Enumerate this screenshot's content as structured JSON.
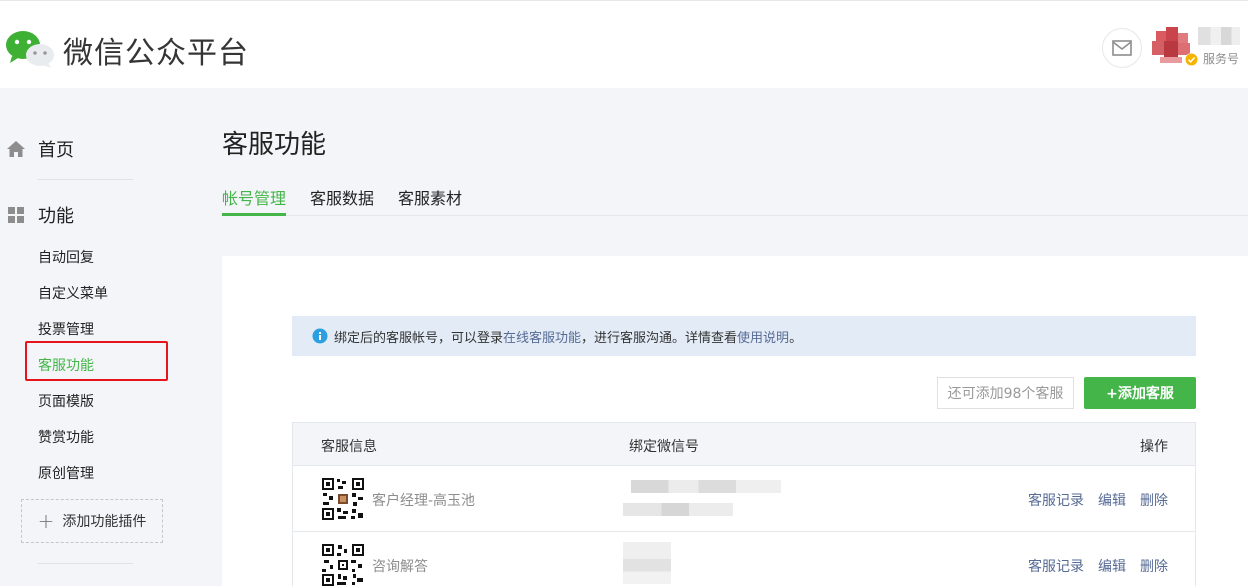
{
  "header": {
    "logo_text": "微信公众平台",
    "account_type": "服务号"
  },
  "sidebar": {
    "home_label": "首页",
    "function_label": "功能",
    "items": [
      {
        "label": "自动回复"
      },
      {
        "label": "自定义菜单"
      },
      {
        "label": "投票管理"
      },
      {
        "label": "客服功能",
        "active": true
      },
      {
        "label": "页面模版"
      },
      {
        "label": "赞赏功能"
      },
      {
        "label": "原创管理"
      }
    ],
    "add_plugin_label": "添加功能插件"
  },
  "main": {
    "title": "客服功能",
    "tabs": [
      {
        "label": "帐号管理",
        "active": true
      },
      {
        "label": "客服数据"
      },
      {
        "label": "客服素材"
      }
    ],
    "notice": {
      "text_before": "绑定后的客服帐号，可以登录",
      "link1": "在线客服功能",
      "text_middle": "，进行客服沟通。详情查看",
      "link2": "使用说明",
      "text_after": "。"
    },
    "quota_text": "还可添加98个客服",
    "add_button": "+添加客服",
    "table": {
      "headers": {
        "info": "客服信息",
        "wechat": "绑定微信号",
        "ops": "操作"
      },
      "rows": [
        {
          "name": "客户经理-高玉池",
          "ops": {
            "records": "客服记录",
            "edit": "编辑",
            "delete": "删除"
          }
        },
        {
          "name": "咨询解答",
          "ops": {
            "records": "客服记录",
            "edit": "编辑",
            "delete": "删除"
          }
        }
      ]
    }
  },
  "colors": {
    "accent_green": "#44b549",
    "link_blue": "#576b95",
    "highlight_red": "#e8141b",
    "notice_bg": "#e2ebf6"
  }
}
